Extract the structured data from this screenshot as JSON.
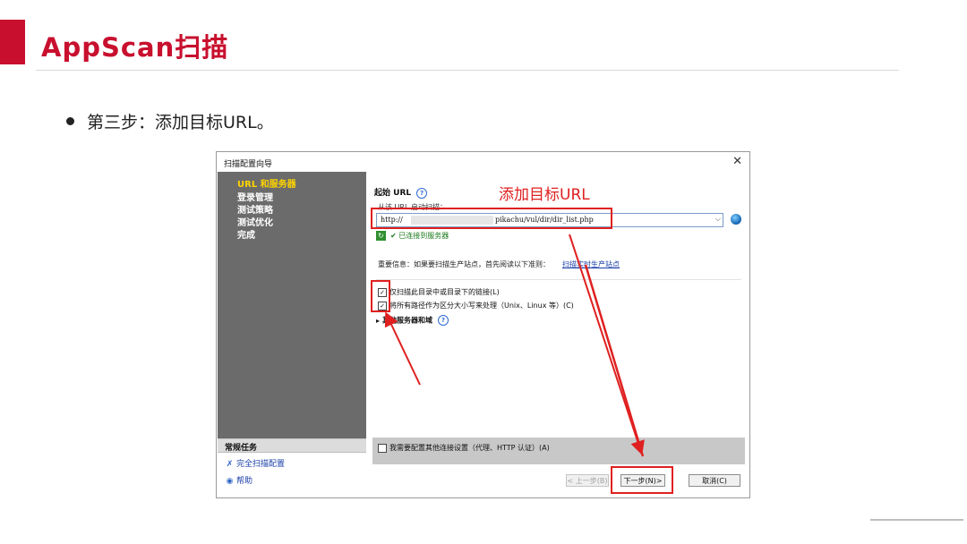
{
  "slide": {
    "title": "AppScan扫描",
    "bullet": "第三步：添加目标URL。"
  },
  "colors": {
    "accent_red": "#c8102e",
    "annotation_red": "#e02020",
    "sidebar_gray": "#6b6b6b",
    "active_step": "#ffd400",
    "link_blue": "#1a3fa8"
  },
  "dialog": {
    "title": "扫描配置向导",
    "close_icon": "close-icon",
    "steps": [
      "URL 和服务器",
      "登录管理",
      "测试策略",
      "测试优化",
      "完成"
    ],
    "active_step": "URL 和服务器",
    "tasks": {
      "header": "常规任务",
      "full_config": "完全扫描配置",
      "help": "帮助"
    },
    "start_url_label": "起始 URL",
    "from_url_label": "从该 URL 启动扫描：",
    "url_prefix": "http://",
    "url_suffix": "pikachu/vul/dir/dir_list.php",
    "connected_status": "已连接到服务器",
    "important_info": "重要信息：如果要扫描生产站点，首先阅读以下准则：",
    "important_link": "扫描实时生产站点",
    "option_only_dir": "仅扫描此目录中或目录下的链接(L)",
    "option_case": "将所有路径作为区分大小写来处理（Unix、Linux 等）(C)",
    "other_servers": "其他服务器和域",
    "proxy_option": "我需要配置其他连接设置（代理、HTTP 认证）(A)",
    "btn_back": "< 上一步(B)",
    "btn_next": "下一步(N)>",
    "btn_cancel": "取消(C)"
  },
  "annotation": {
    "label": "添加目标URL"
  }
}
